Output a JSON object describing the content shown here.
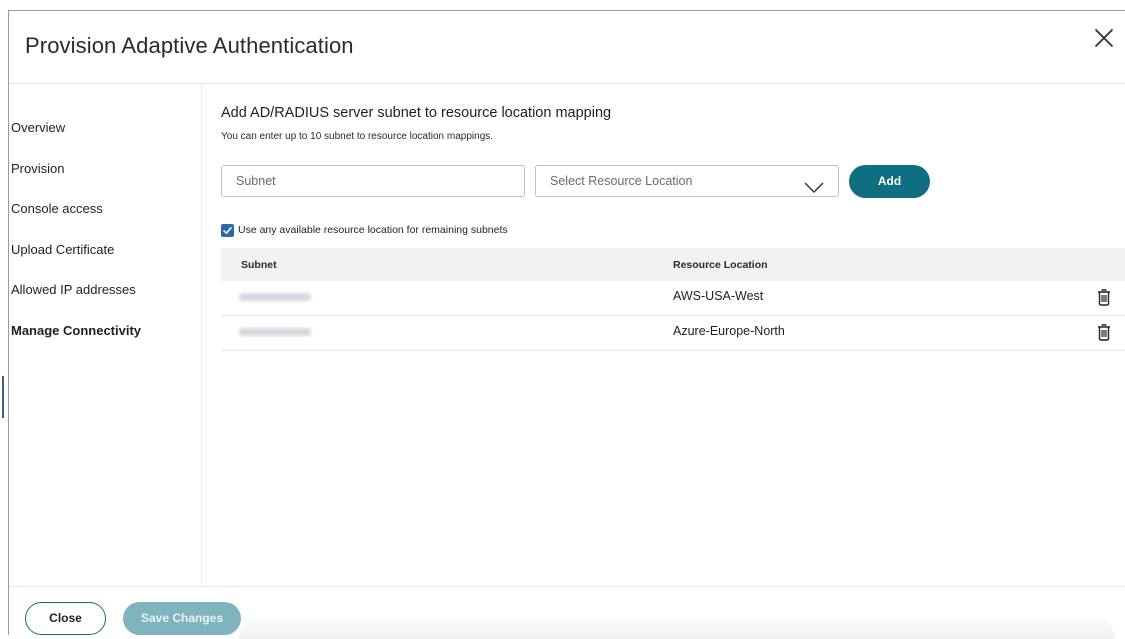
{
  "dialog": {
    "title": "Provision Adaptive Authentication"
  },
  "sidebar": {
    "items": [
      {
        "label": "Overview"
      },
      {
        "label": "Provision"
      },
      {
        "label": "Console access"
      },
      {
        "label": "Upload Certificate"
      },
      {
        "label": "Allowed IP addresses"
      },
      {
        "label": "Manage Connectivity"
      }
    ],
    "active": "Manage Connectivity"
  },
  "main": {
    "section_title": "Add AD/RADIUS server subnet to resource location mapping",
    "section_subtitle": "You can enter up to 10 subnet to resource location mappings.",
    "subnet_input": {
      "placeholder": "Subnet",
      "value": ""
    },
    "resource_select": {
      "selected": "Select Resource Location"
    },
    "add_label": "Add",
    "checkbox": {
      "label": "Use any available resource location for remaining subnets",
      "checked": true
    },
    "table": {
      "headers": [
        "Subnet",
        "Resource Location"
      ],
      "rows": [
        {
          "location": "AWS-USA-West"
        },
        {
          "location": "Azure-Europe-North"
        }
      ]
    }
  },
  "footer": {
    "close_label": "Close",
    "save_label": "Save Changes"
  },
  "icons": {
    "close": "close-icon",
    "dropdown": "chevron-down-icon",
    "delete": "trash-icon",
    "check": "checkmark-icon"
  },
  "colors": {
    "primary": "#0f6e82",
    "primary_disabled": "#7fb3be",
    "checkbox": "#2b6aa6"
  }
}
